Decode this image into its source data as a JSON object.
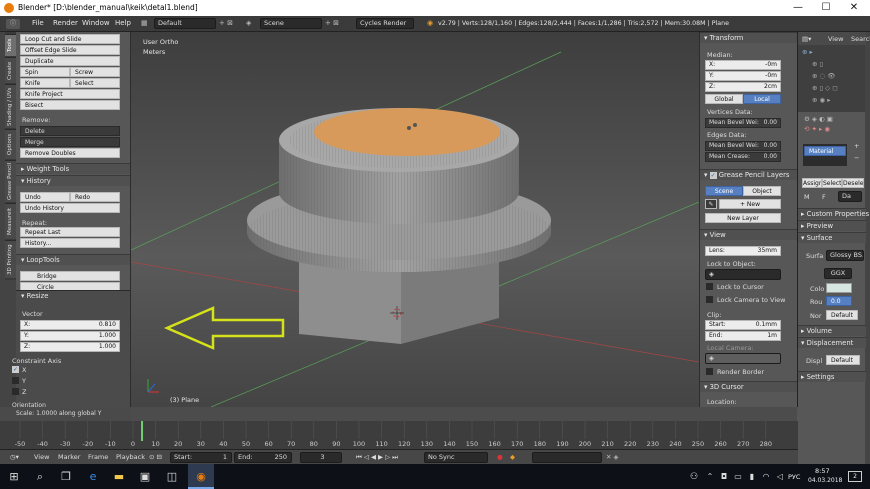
{
  "window": {
    "title": "Blender* [D:\\blender_manual\\keik\\detal1.blend]",
    "minimize": "—",
    "maximize": "☐",
    "close": "✕"
  },
  "menubar": {
    "items": [
      "File",
      "Render",
      "Window",
      "Help"
    ],
    "layout": "Default",
    "scene": "Scene",
    "engine": "Cycles Render",
    "stats": "v2.79 | Verts:128/1,160 | Edges:128/2,444 | Faces:1/1,286 | Tris:2,572 | Mem:30.08M | Plane"
  },
  "tool_tabs": [
    "Tools",
    "Create",
    "Shading / UVs",
    "Options",
    "Grease Pencil",
    "Measureit",
    "3D Printing"
  ],
  "tools": {
    "loop_cut": "Loop Cut and Slide",
    "offset_edge": "Offset Edge Slide",
    "duplicate": "Duplicate",
    "spin": "Spin",
    "screw": "Screw",
    "knife": "Knife",
    "select": "Select",
    "knife_project": "Knife Project",
    "bisect": "Bisect",
    "remove_label": "Remove:",
    "delete": "Delete",
    "merge": "Merge",
    "remove_doubles": "Remove Doubles",
    "weight_tools": "Weight Tools",
    "history": "History",
    "undo": "Undo",
    "redo": "Redo",
    "undo_history": "Undo History",
    "repeat_label": "Repeat:",
    "repeat_last": "Repeat Last",
    "history_btn": "History...",
    "looptools": "LoopTools",
    "bridge": "Bridge",
    "circle": "Circle"
  },
  "resize": {
    "title": "Resize",
    "vector_label": "Vector",
    "x_label": "X:",
    "x": "0.810",
    "y_label": "Y:",
    "y": "1.000",
    "z_label": "Z:",
    "z": "1.000",
    "constraint_label": "Constraint Axis",
    "cx": "X",
    "cy": "Y",
    "cz": "Z",
    "orientation": "Orientation"
  },
  "status": {
    "scale": "Scale: 1.0000 along global Y"
  },
  "viewport": {
    "mode": "User Ortho",
    "units": "Meters",
    "object": "(3) Plane"
  },
  "npanel": {
    "transform": "Transform",
    "median": "Median:",
    "x_label": "X:",
    "x": "-0m",
    "y_label": "Y:",
    "y": "-0m",
    "z_label": "Z:",
    "z": "2cm",
    "global": "Global",
    "local": "Local",
    "vertices_data": "Vertices Data:",
    "mean_bevel_v": "Mean Bevel Wei:",
    "mean_bevel_v_val": "0.00",
    "edges_data": "Edges Data:",
    "mean_bevel_e": "Mean Bevel Wei:",
    "mean_bevel_e_val": "0.00",
    "mean_crease": "Mean Crease:",
    "mean_crease_val": "0.00",
    "gp_layers": "Grease Pencil Layers",
    "scene": "Scene",
    "object": "Object",
    "new": "New",
    "new_layer": "New Layer",
    "view": "View",
    "lens": "Lens:",
    "lens_val": "35mm",
    "lock_to_object": "Lock to Object:",
    "lock_to_cursor": "Lock to Cursor",
    "lock_camera": "Lock Camera to View",
    "clip": "Clip:",
    "start": "Start:",
    "start_val": "0.1mm",
    "end": "End:",
    "end_val": "1m",
    "local_camera": "Local Camera:",
    "render_border": "Render Border",
    "cursor_3d": "3D Cursor",
    "location": "Location:"
  },
  "outliner": {
    "view": "View",
    "search": "Search"
  },
  "properties": {
    "material": "Material",
    "assign": "Assign",
    "select": "Select",
    "deselect": "Desele",
    "custom_props": "Custom Properties",
    "preview": "Preview",
    "surface": "Surface",
    "surface_label": "Surfa",
    "shader": "Glossy BS...",
    "ggx": "GGX",
    "color": "Colo",
    "roughness": "Rou",
    "roughness_val": "0.0",
    "normal": "Nor",
    "normal_val": "Default",
    "volume": "Volume",
    "displacement": "Displacement",
    "disp_label": "Displ",
    "disp_val": "Default",
    "settings": "Settings",
    "data_short": "Da",
    "m_short": "M",
    "f_short": "F"
  },
  "timeline": {
    "ticks": [
      "-50",
      "-40",
      "-30",
      "-20",
      "-10",
      "0",
      "10",
      "20",
      "30",
      "40",
      "50",
      "60",
      "70",
      "80",
      "90",
      "100",
      "110",
      "120",
      "130",
      "140",
      "150",
      "160",
      "170",
      "180",
      "190",
      "200",
      "210",
      "220",
      "230",
      "240",
      "250",
      "260",
      "270",
      "280"
    ],
    "current_frame": 4,
    "view": "View",
    "marker": "Marker",
    "frame": "Frame",
    "playback": "Playback",
    "start_label": "Start:",
    "start": "1",
    "end_label": "End:",
    "end": "250",
    "frame_val": "3",
    "sync": "No Sync"
  },
  "taskbar": {
    "time": "8:57",
    "date": "04.03.2018",
    "lang": "РУС",
    "notif": "2"
  },
  "colors": {
    "accent": "#5680c2",
    "arrow": "#d4e21a",
    "gold": "#d79a5a"
  }
}
